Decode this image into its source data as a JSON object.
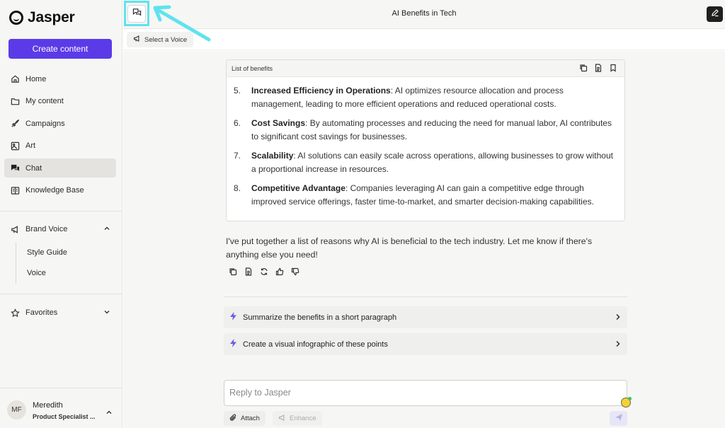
{
  "brand": {
    "name": "Jasper"
  },
  "sidebar": {
    "create_label": "Create content",
    "nav": [
      {
        "label": "Home",
        "icon": "home-icon"
      },
      {
        "label": "My content",
        "icon": "folder-icon"
      },
      {
        "label": "Campaigns",
        "icon": "rocket-icon"
      },
      {
        "label": "Art",
        "icon": "image-icon"
      },
      {
        "label": "Chat",
        "icon": "chat-icon",
        "active": true
      },
      {
        "label": "Knowledge Base",
        "icon": "book-icon"
      }
    ],
    "brand_voice": {
      "label": "Brand Voice",
      "items": [
        "Style Guide",
        "Voice"
      ]
    },
    "favorites": {
      "label": "Favorites"
    },
    "user": {
      "initials": "MF",
      "name": "Meredith",
      "role": "Product Specialist ..."
    }
  },
  "header": {
    "title": "AI Benefits in Tech",
    "voice_label": "Select a Voice"
  },
  "card": {
    "title": "List of benefits",
    "items": [
      {
        "num": "5.",
        "bold": "Increased Efficiency in Operations",
        "text": ": AI optimizes resource allocation and process management, leading to more efficient operations and reduced operational costs."
      },
      {
        "num": "6.",
        "bold": "Cost Savings",
        "text": ": By automating processes and reducing the need for manual labor, AI contributes to significant cost savings for businesses."
      },
      {
        "num": "7.",
        "bold": "Scalability",
        "text": ": AI solutions can easily scale across operations, allowing businesses to grow without a proportional increase in resources."
      },
      {
        "num": "8.",
        "bold": "Competitive Advantage",
        "text": ": Companies leveraging AI can gain a competitive edge through improved service offerings, faster time-to-market, and smarter decision-making capabilities."
      }
    ]
  },
  "reply": {
    "text": "I've put together a list of reasons why AI is beneficial to the tech industry. Let me know if there's anything else you need!"
  },
  "suggestions": [
    "Summarize the benefits in a short paragraph",
    "Create a visual infographic of these points"
  ],
  "composer": {
    "placeholder": "Reply to Jasper",
    "attach_label": "Attach",
    "enhance_label": "Enhance"
  },
  "colors": {
    "accent": "#5b3be8",
    "highlight": "#5fe3ee"
  }
}
